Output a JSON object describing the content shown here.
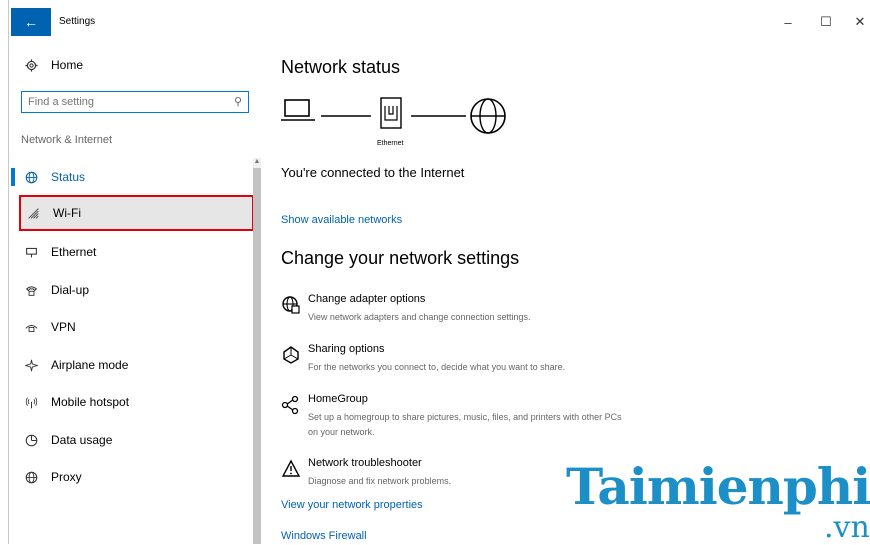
{
  "window": {
    "title": "Settings",
    "minimize": "–",
    "maximize": "☐",
    "close": "✕"
  },
  "sidebar": {
    "home_label": "Home",
    "search": {
      "placeholder": "Find a setting",
      "value": ""
    },
    "section_label": "Network & Internet",
    "items": [
      {
        "label": "Status",
        "icon": "status-globe-icon",
        "active": true
      },
      {
        "label": "Wi-Fi",
        "icon": "wifi-icon",
        "highlighted": true
      },
      {
        "label": "Ethernet",
        "icon": "ethernet-icon"
      },
      {
        "label": "Dial-up",
        "icon": "dialup-icon"
      },
      {
        "label": "VPN",
        "icon": "vpn-icon"
      },
      {
        "label": "Airplane mode",
        "icon": "airplane-icon"
      },
      {
        "label": "Mobile hotspot",
        "icon": "hotspot-icon"
      },
      {
        "label": "Data usage",
        "icon": "data-usage-icon"
      },
      {
        "label": "Proxy",
        "icon": "proxy-globe-icon"
      }
    ]
  },
  "main": {
    "network_status_heading": "Network status",
    "ethernet_caption": "Ethernet",
    "connected_text": "You're connected to the Internet",
    "show_networks_link": "Show available networks",
    "change_heading": "Change your network settings",
    "options": [
      {
        "title": "Change adapter options",
        "desc": "View network adapters and change connection settings.",
        "icon": "adapter-globe-icon"
      },
      {
        "title": "Sharing options",
        "desc": "For the networks you connect to, decide what you want to share.",
        "icon": "sharing-icon"
      },
      {
        "title": "HomeGroup",
        "desc": "Set up a homegroup to share pictures, music, files, and printers with other PCs on your network.",
        "icon": "homegroup-icon"
      },
      {
        "title": "Network troubleshooter",
        "desc": "Diagnose and fix network problems.",
        "icon": "warning-icon"
      }
    ],
    "view_properties_link": "View your network properties",
    "firewall_link": "Windows Firewall"
  },
  "watermark": {
    "text": "Taimienphi",
    "suffix": ".vn"
  },
  "colors": {
    "accent": "#0078d7",
    "link": "#0063b1",
    "highlight_border": "#e0000a",
    "watermark": "#1b8fc6"
  }
}
